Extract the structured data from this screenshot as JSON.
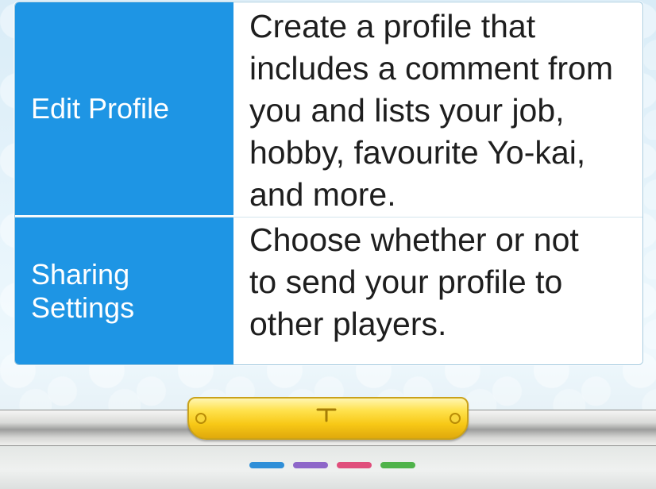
{
  "info_table": {
    "rows": [
      {
        "label": "Edit Profile",
        "description": "Create a profile that\nincludes a comment from\nyou and lists your job,\nhobby, favourite Yo-kai,\nand more."
      },
      {
        "label": "Sharing\nSettings",
        "description": "Choose whether or not\nto send your profile to\nother players."
      }
    ]
  },
  "colors": {
    "label_background": "#1e95e4",
    "description_background": "#ffffff",
    "hinge_yellow": "#f7c816",
    "dash_colors": [
      "#2f8fd8",
      "#8e67c9",
      "#e04f7c",
      "#4fb34a"
    ]
  },
  "icons": {
    "hinge_mark": "down-arrow-mark-icon",
    "hinge_screws": "screw-dot-icon"
  }
}
